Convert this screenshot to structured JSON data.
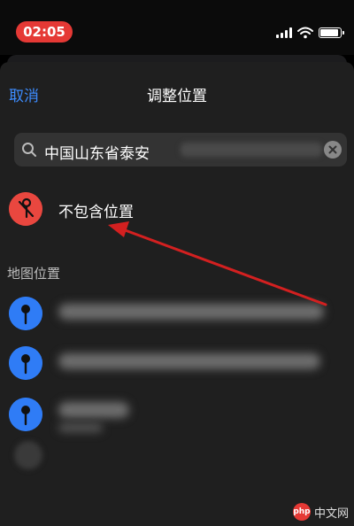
{
  "status_bar": {
    "time": "02:05",
    "accent": "#e53935"
  },
  "nav": {
    "cancel_label": "取消",
    "title": "调整位置"
  },
  "search": {
    "query": "中国山东省泰安",
    "icon": "search-icon",
    "clear_icon": "clear-icon"
  },
  "no_location": {
    "label": "不包含位置",
    "icon": "no-location-icon",
    "color": "#e9473f"
  },
  "map_section": {
    "label": "地图位置"
  },
  "locations": [
    {
      "icon": "map-pin-icon",
      "color": "#2f7cf6"
    },
    {
      "icon": "map-pin-icon",
      "color": "#2f7cf6"
    },
    {
      "icon": "map-pin-icon",
      "color": "#2f7cf6"
    }
  ],
  "annotation": {
    "color": "#d32020",
    "icon": "arrow-annotation"
  },
  "watermark": {
    "logo": "php",
    "text": "中文网"
  }
}
